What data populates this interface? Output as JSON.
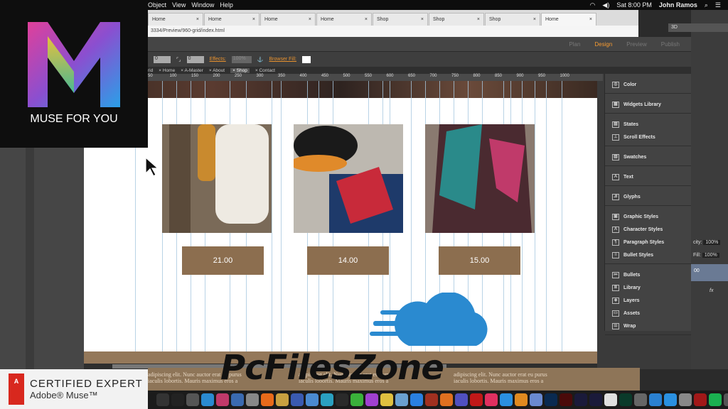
{
  "menubar": {
    "items": [
      "Object",
      "View",
      "Window",
      "Help"
    ],
    "clock": "Sat 8:00 PM",
    "user": "John Ramos"
  },
  "logo": {
    "caption": "MUSE FOR YOU"
  },
  "browser": {
    "tabs": [
      "Home",
      "Home",
      "Home",
      "Home",
      "Shop",
      "Shop",
      "Shop",
      "Home"
    ],
    "url": "3334/Preview/960-grid/index.html"
  },
  "muse": {
    "modes": [
      "Plan",
      "Design",
      "Preview",
      "Publish"
    ],
    "active_mode": "Design",
    "toolbar": {
      "field1": "0",
      "field2": "0",
      "effects_label": "Effects:",
      "opacity": "100%",
      "browser_fill_label": "Browser Fill:"
    },
    "page_tabs": [
      "rid",
      "Home",
      "A-Master",
      "About",
      "Shop",
      "Contact"
    ],
    "active_page": "Shop",
    "ruler": [
      "50",
      "100",
      "150",
      "200",
      "250",
      "300",
      "350",
      "400",
      "450",
      "500",
      "550",
      "600",
      "650",
      "700",
      "750",
      "800",
      "850",
      "900",
      "950",
      "1000"
    ],
    "products": [
      {
        "price": "21.00"
      },
      {
        "price": "14.00"
      },
      {
        "price": "15.00"
      }
    ],
    "footer_text": [
      "adipiscing elit. Nunc auctor erat eu purus iaculis lobortis. Mauris maximus eros a",
      "adipiscing elit. Nunc auctor erat eu purus iaculis lobortis. Mauris maximus eros a",
      "adipiscing elit. Nunc auctor erat eu purus iaculis lobortis. Mauris maximus eros a"
    ]
  },
  "panel": {
    "groups": [
      [
        "Color"
      ],
      [
        "Widgets Library"
      ],
      [
        "States",
        "Scroll Effects"
      ],
      [
        "Swatches"
      ],
      [
        "Text"
      ],
      [
        "Glyphs"
      ],
      [
        "Graphic Styles",
        "Character Styles",
        "Paragraph Styles",
        "Bullet Styles"
      ],
      [
        "Bullets",
        "Library",
        "Layers",
        "Assets",
        "Wrap"
      ]
    ]
  },
  "photoshop": {
    "mode": "3D",
    "opacity_label": "city:",
    "opacity": "100%",
    "fill_label": "Fill:",
    "fill": "100%",
    "layer": "00",
    "fx": "fx"
  },
  "badge": {
    "line1": "CERTIFIED EXPERT",
    "line2": "Adobe® Muse™",
    "adobe": "Adobe"
  },
  "watermark": "PcFilesZone",
  "colors": {
    "accent": "#f59a32",
    "price_bg": "#8c6e4f",
    "footer": "#94785a"
  }
}
